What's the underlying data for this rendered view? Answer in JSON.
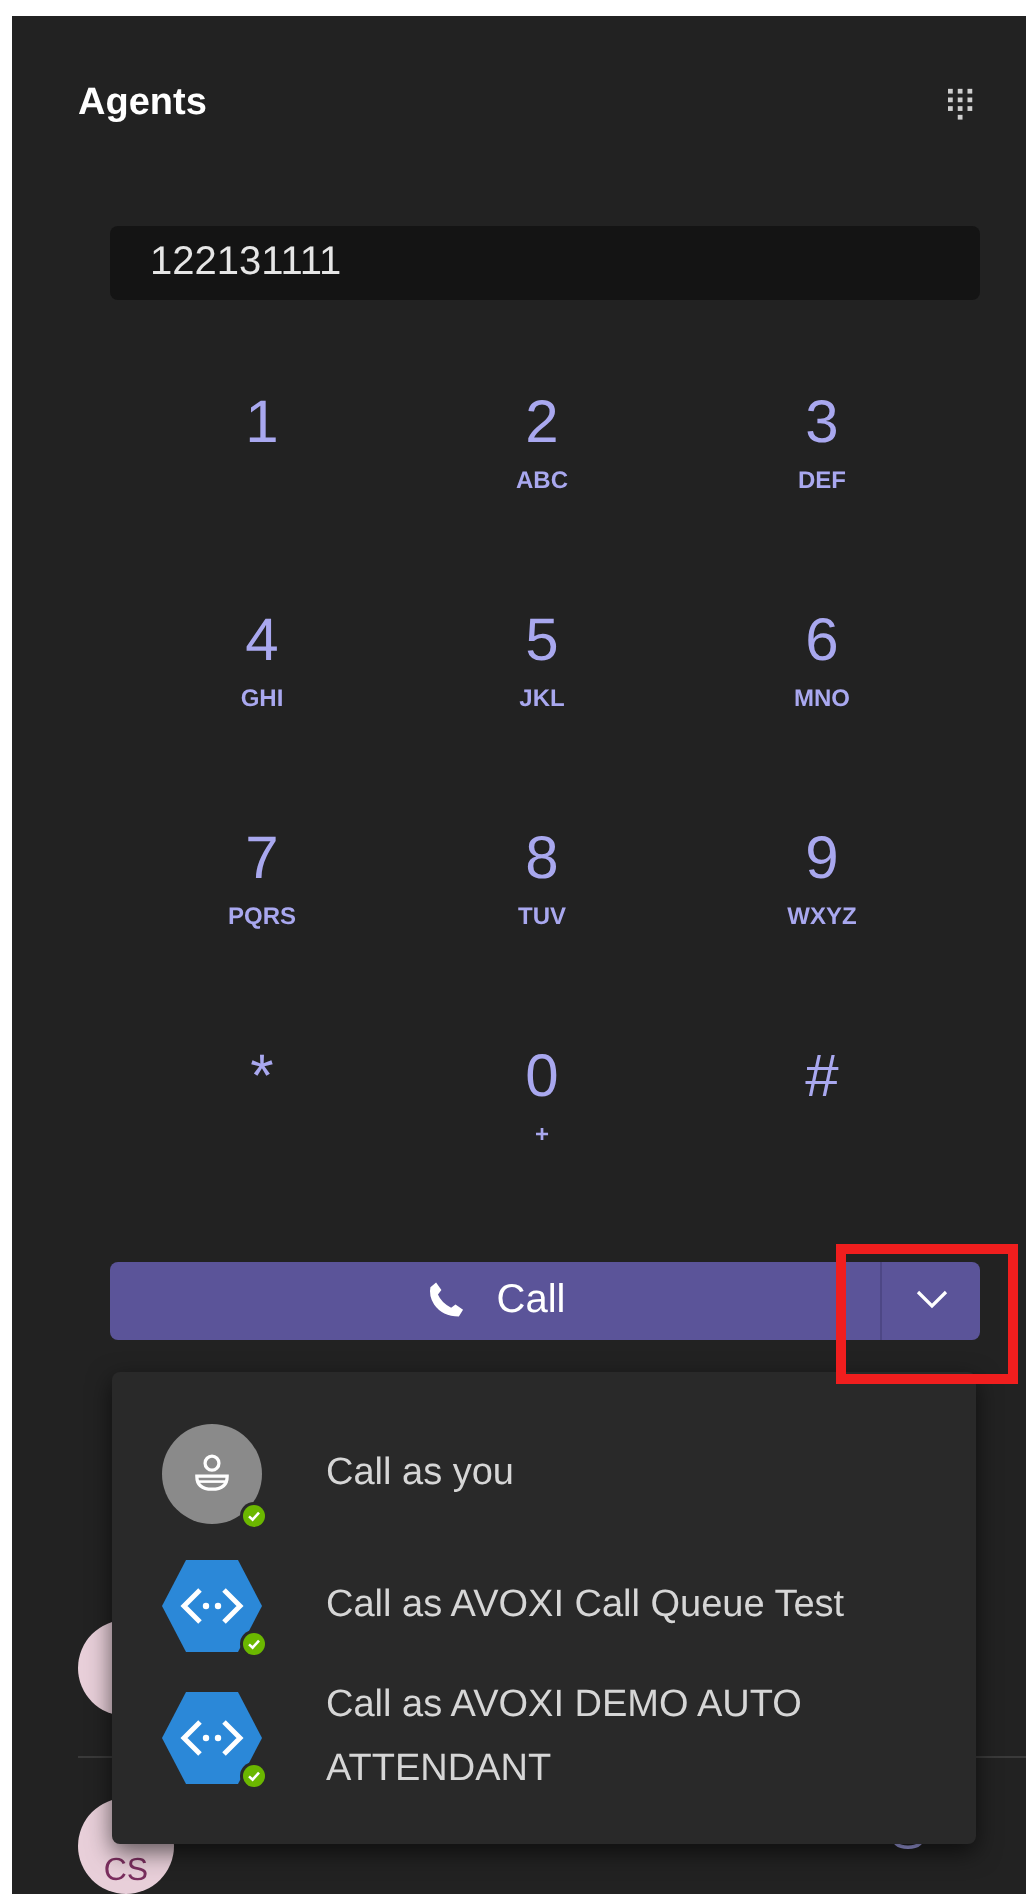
{
  "header": {
    "title": "Agents"
  },
  "dial_field": {
    "value": "122131111"
  },
  "keypad": [
    {
      "digit": "1"
    },
    {
      "digit": "2",
      "letters": "ABC"
    },
    {
      "digit": "3",
      "letters": "DEF"
    },
    {
      "digit": "4",
      "letters": "GHI"
    },
    {
      "digit": "5",
      "letters": "JKL"
    },
    {
      "digit": "6",
      "letters": "MNO"
    },
    {
      "digit": "7",
      "letters": "PQRS"
    },
    {
      "digit": "8",
      "letters": "TUV"
    },
    {
      "digit": "9",
      "letters": "WXYZ"
    },
    {
      "digit": "*"
    },
    {
      "digit": "0",
      "letters": "+"
    },
    {
      "digit": "#"
    }
  ],
  "call_button": {
    "label": "Call"
  },
  "call_menu": {
    "expanded": true,
    "items": [
      {
        "kind": "person",
        "label": "Call as you"
      },
      {
        "kind": "bot",
        "label": "Call as AVOXI Call Queue Test"
      },
      {
        "kind": "bot",
        "label": "Call as AVOXI DEMO AUTO ATTENDANT"
      }
    ]
  },
  "contacts": [
    {
      "initials": "CS"
    }
  ]
}
